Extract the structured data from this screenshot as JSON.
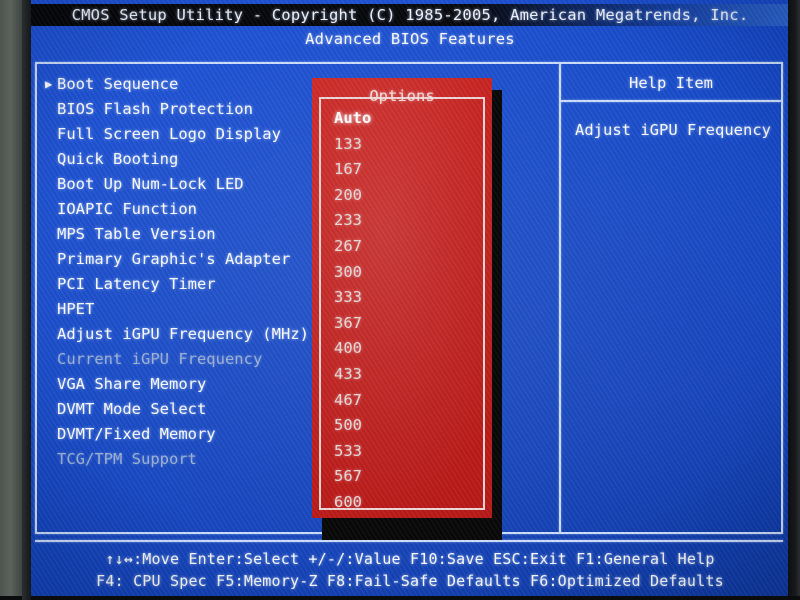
{
  "window": {
    "title": "CMOS Setup Utility - Copyright (C) 1985-2005, American Megatrends, Inc.",
    "subtitle": "Advanced BIOS Features"
  },
  "colors": {
    "screen_blue": "#1348cb",
    "popup_red": "#c31f1d",
    "titlebar_black": "#07080d",
    "text_white": "#ffffff",
    "text_disabled": "#9fb4d8",
    "border_light": "#cfe0ff"
  },
  "settings": {
    "items": [
      {
        "label": "Boot Sequence",
        "submenu": true,
        "disabled": false
      },
      {
        "label": "BIOS Flash Protection",
        "submenu": false,
        "disabled": false
      },
      {
        "label": "Full Screen Logo Display",
        "submenu": false,
        "disabled": false
      },
      {
        "label": "Quick Booting",
        "submenu": false,
        "disabled": false
      },
      {
        "label": "Boot Up Num-Lock LED",
        "submenu": false,
        "disabled": false
      },
      {
        "label": "IOAPIC Function",
        "submenu": false,
        "disabled": false
      },
      {
        "label": "MPS Table Version",
        "submenu": false,
        "disabled": false
      },
      {
        "label": "Primary Graphic's Adapter",
        "submenu": false,
        "disabled": false
      },
      {
        "label": "PCI Latency Timer",
        "submenu": false,
        "disabled": false
      },
      {
        "label": "HPET",
        "submenu": false,
        "disabled": false
      },
      {
        "label": "Adjust iGPU Frequency (MHz)",
        "submenu": false,
        "disabled": false
      },
      {
        "label": "Current iGPU Frequency",
        "submenu": false,
        "disabled": true
      },
      {
        "label": "VGA Share Memory",
        "submenu": false,
        "disabled": false
      },
      {
        "label": "DVMT Mode Select",
        "submenu": false,
        "disabled": false
      },
      {
        "label": "DVMT/Fixed Memory",
        "submenu": false,
        "disabled": false
      },
      {
        "label": "TCG/TPM Support",
        "submenu": false,
        "disabled": true
      }
    ],
    "submenu_glyph": "▶"
  },
  "options_popup": {
    "title": "Options",
    "selected": "Auto",
    "items": [
      "Auto",
      "133",
      "167",
      "200",
      "233",
      "267",
      "300",
      "333",
      "367",
      "400",
      "433",
      "467",
      "500",
      "533",
      "567",
      "600"
    ]
  },
  "help_panel": {
    "title": "Help Item",
    "text": "Adjust iGPU Frequency"
  },
  "footer": {
    "line1": "↑↓↔:Move   Enter:Select   +/-/:Value   F10:Save   ESC:Exit   F1:General Help",
    "line2": "F4: CPU Spec    F5:Memory-Z    F8:Fail-Safe Defaults    F6:Optimized Defaults"
  }
}
